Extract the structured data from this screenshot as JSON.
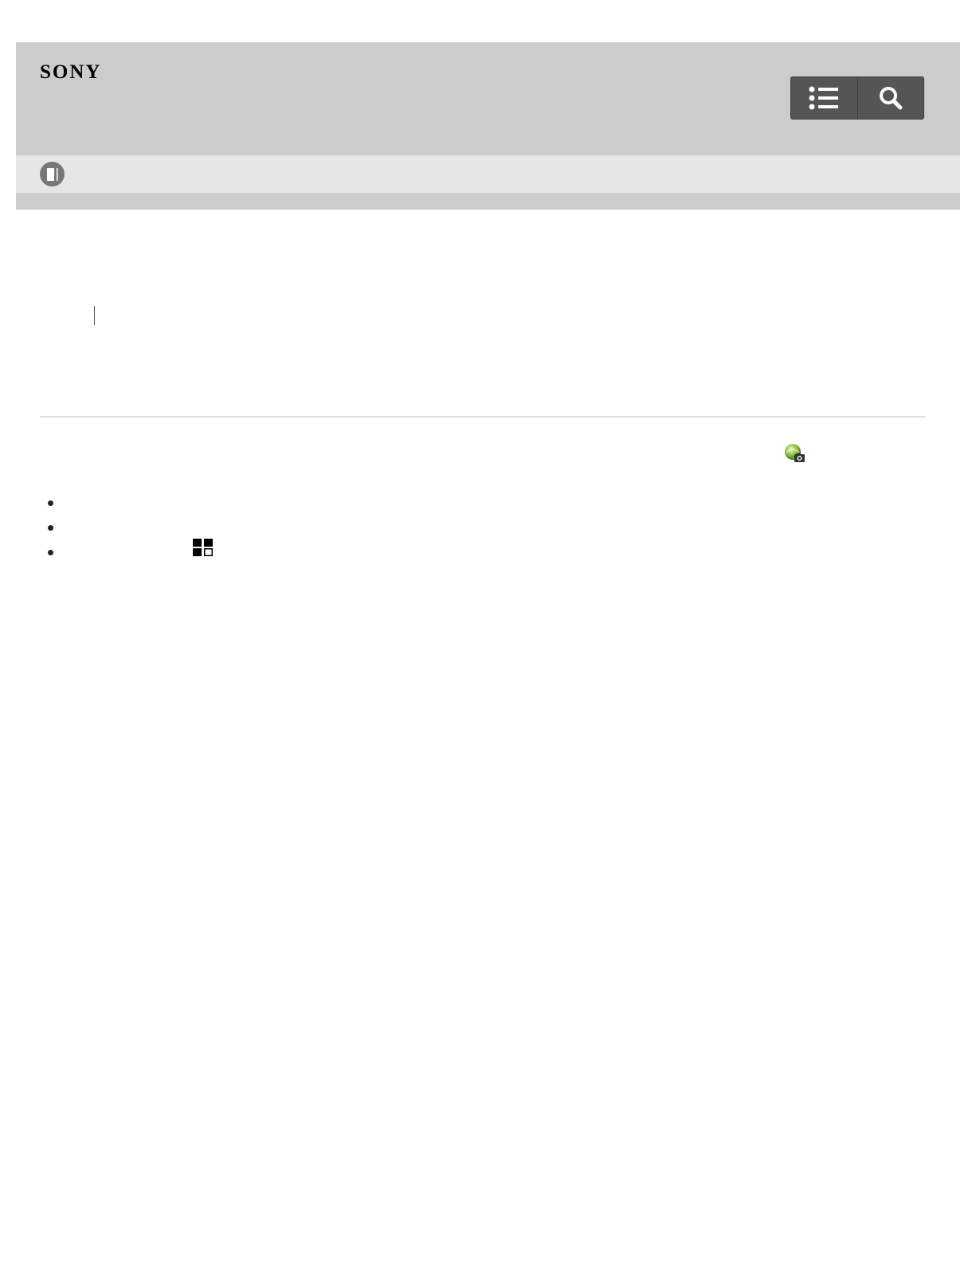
{
  "header": {
    "logo_text": "SONY",
    "background": "#cccccc",
    "buttons": [
      {
        "name": "table-of-contents",
        "icon": "list-icon"
      },
      {
        "name": "search",
        "icon": "search-icon"
      }
    ]
  },
  "subbar": {
    "background": "#e6e6e6",
    "icon": "book-icon"
  },
  "content": {
    "app_icon": "camera-app-icon",
    "bullets": [
      {
        "text": ""
      },
      {
        "text": ""
      },
      {
        "text": "",
        "icon": "grid-icon"
      }
    ]
  }
}
